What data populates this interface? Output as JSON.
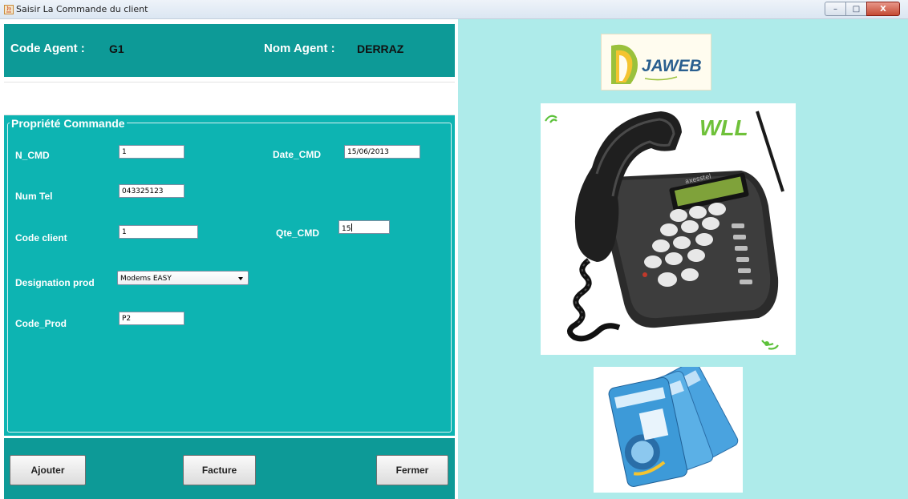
{
  "window": {
    "title": "Saisir La Commande du client",
    "controls": {
      "minimize": "–",
      "maximize": "□",
      "close": "X"
    }
  },
  "agent": {
    "code_label": "Code Agent :",
    "code_value": "G1",
    "name_label": "Nom Agent :",
    "name_value": "DERRAZ"
  },
  "form": {
    "group_title": "Propriété Commande",
    "n_cmd": {
      "label": "N_CMD",
      "value": "1"
    },
    "date_cmd": {
      "label": "Date_CMD",
      "value": "15/06/2013"
    },
    "num_tel": {
      "label": "Num Tel",
      "value": "043325123"
    },
    "code_client": {
      "label": "Code client",
      "value": "1"
    },
    "qte_cmd": {
      "label": "Qte_CMD",
      "value": "15"
    },
    "designation_prod": {
      "label": "Designation prod",
      "selected": "Modems EASY"
    },
    "code_prod": {
      "label": "Code_Prod",
      "value": "P2"
    }
  },
  "buttons": {
    "add": "Ajouter",
    "invoice": "Facture",
    "close": "Fermer"
  },
  "images": {
    "logo_text": "JAWEB",
    "phone_text": "WLL",
    "phone_brand": "axesstel"
  },
  "colors": {
    "agent_bar": "#0d9a97",
    "form_panel": "#0db4b2",
    "right_panel": "#aeebea"
  }
}
